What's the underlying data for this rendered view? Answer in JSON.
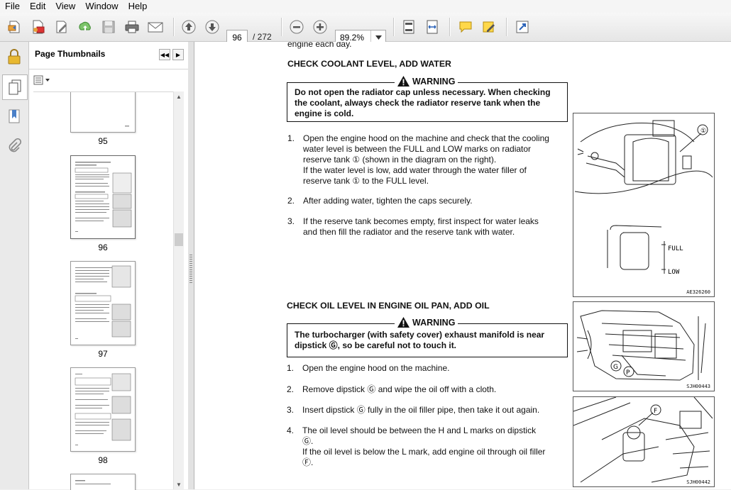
{
  "menu": [
    "File",
    "Edit",
    "View",
    "Window",
    "Help"
  ],
  "toolbar": {
    "current_page": "96",
    "page_total": "/ 272",
    "zoom": "89.2%",
    "icons": [
      "open-icon",
      "create-pdf-icon",
      "edit-icon",
      "upload-icon",
      "save-icon",
      "print-icon",
      "email-icon",
      "prev-page-icon",
      "next-page-icon",
      "zoom-out-icon",
      "zoom-in-icon",
      "fit-page-icon",
      "fit-width-icon",
      "comment-icon",
      "highlight-icon",
      "fullscreen-icon"
    ]
  },
  "panel": {
    "title": "Page Thumbnails",
    "thumbnails": [
      {
        "label": "95"
      },
      {
        "label": "96"
      },
      {
        "label": "97"
      },
      {
        "label": "98"
      }
    ]
  },
  "doc": {
    "top_fragment": "engine each day.",
    "section1": {
      "heading": "CHECK COOLANT LEVEL, ADD WATER",
      "warning_title": "WARNING",
      "warning_lines": [
        "Do not open the radiator cap unless necessary. When checking",
        "the coolant, always check the radiator reserve tank when the",
        "engine is cold."
      ],
      "steps": [
        {
          "num": "1.",
          "lines": [
            "Open the engine hood on the machine and check that the cooling",
            "water level is between the FULL and LOW marks on radiator",
            "reserve tank ① (shown in the diagram on the right).",
            "If the water level is low, add water through the water filler of",
            "reserve tank ① to the FULL level."
          ]
        },
        {
          "num": "2.",
          "lines": [
            "After adding water, tighten the caps securely."
          ]
        },
        {
          "num": "3.",
          "lines": [
            "If the reserve tank becomes empty, first inspect for water leaks",
            "and then fill the radiator and the reserve tank with water."
          ]
        }
      ],
      "figure": {
        "callout": "①",
        "full": "FULL",
        "low": "LOW",
        "code": "AE326260"
      }
    },
    "section2": {
      "heading": "CHECK OIL LEVEL IN ENGINE OIL PAN, ADD OIL",
      "warning_title": "WARNING",
      "warning_lines": [
        "The turbocharger (with safety cover) exhaust manifold is near",
        "dipstick Ⓖ, so be careful not to touch it."
      ],
      "steps": [
        {
          "num": "1.",
          "lines": [
            "Open the engine hood on the machine."
          ]
        },
        {
          "num": "2.",
          "lines": [
            "Remove dipstick Ⓖ and wipe the oil off with a cloth."
          ]
        },
        {
          "num": "3.",
          "lines": [
            "Insert dipstick Ⓖ fully in the oil filler pipe, then take it out again."
          ]
        },
        {
          "num": "4.",
          "lines": [
            "The oil level should be between the H and L marks on dipstick",
            "Ⓖ.",
            "If the oil level is below the L mark, add engine oil through oil filler",
            "Ⓕ."
          ]
        }
      ],
      "figure2": {
        "callout_g": "G",
        "callout_p": "P",
        "code": "SJH00443"
      },
      "figure3": {
        "callout_f": "F",
        "code": "SJH00442"
      }
    }
  }
}
